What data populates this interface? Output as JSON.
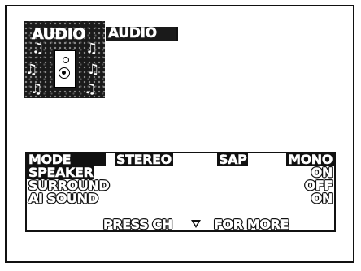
{
  "icon": {
    "title": "AUDIO",
    "notes": [
      "♫",
      "♫",
      "♫",
      "♫",
      "♫",
      "♫"
    ]
  },
  "header": {
    "label": "AUDIO"
  },
  "menu": {
    "mode": {
      "label": "MODE",
      "options": [
        "STEREO",
        "SAP",
        "MONO"
      ]
    },
    "speaker": {
      "label": "SPEAKER",
      "value": "ON"
    },
    "surround": {
      "label": "SURROUND",
      "value": "OFF"
    },
    "ai_sound": {
      "label": "AI SOUND",
      "value": "ON"
    },
    "footer": {
      "press": "PRESS CH",
      "more": "FOR MORE"
    }
  },
  "colors": {
    "fg": "#111111",
    "bg": "#ffffff"
  }
}
